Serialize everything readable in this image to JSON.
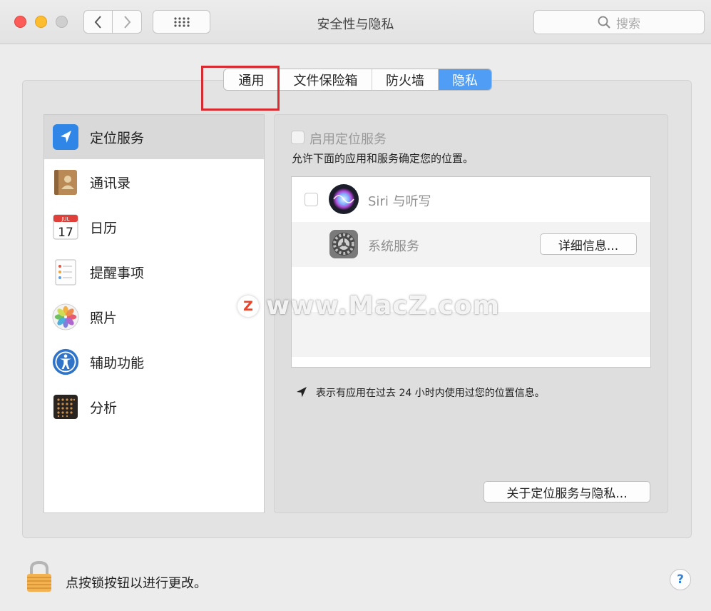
{
  "window": {
    "title": "安全性与隐私",
    "search_placeholder": "搜索"
  },
  "tabs": [
    {
      "label": "通用",
      "active": false
    },
    {
      "label": "文件保险箱",
      "active": false
    },
    {
      "label": "防火墙",
      "active": false
    },
    {
      "label": "隐私",
      "active": true
    }
  ],
  "sidebar": {
    "items": [
      {
        "label": "定位服务",
        "icon": "location-arrow-icon",
        "selected": true
      },
      {
        "label": "通讯录",
        "icon": "contacts-icon",
        "selected": false
      },
      {
        "label": "日历",
        "icon": "calendar-icon",
        "selected": false
      },
      {
        "label": "提醒事项",
        "icon": "reminders-icon",
        "selected": false
      },
      {
        "label": "照片",
        "icon": "photos-icon",
        "selected": false
      },
      {
        "label": "辅助功能",
        "icon": "accessibility-icon",
        "selected": false
      },
      {
        "label": "分析",
        "icon": "analytics-icon",
        "selected": false
      }
    ]
  },
  "calendar_icon": {
    "month": "JUL",
    "day": "17"
  },
  "location": {
    "enable_label": "启用定位服务",
    "description": "允许下面的应用和服务确定您的位置。",
    "apps": [
      {
        "label": "Siri 与听写",
        "icon": "siri-icon"
      },
      {
        "label": "系统服务",
        "icon": "system-preferences-icon"
      }
    ],
    "details_button": "详细信息...",
    "legend": "表示有应用在过去 24 小时内使用过您的位置信息。",
    "about_button": "关于定位服务与隐私..."
  },
  "watermark": {
    "badge": "Z",
    "text": "www.MacZ.com"
  },
  "footer": {
    "lock_text": "点按锁按钮以进行更改。",
    "help_label": "?"
  },
  "colors": {
    "accent": "#4f9df5",
    "highlight_box": "#d62b31"
  }
}
